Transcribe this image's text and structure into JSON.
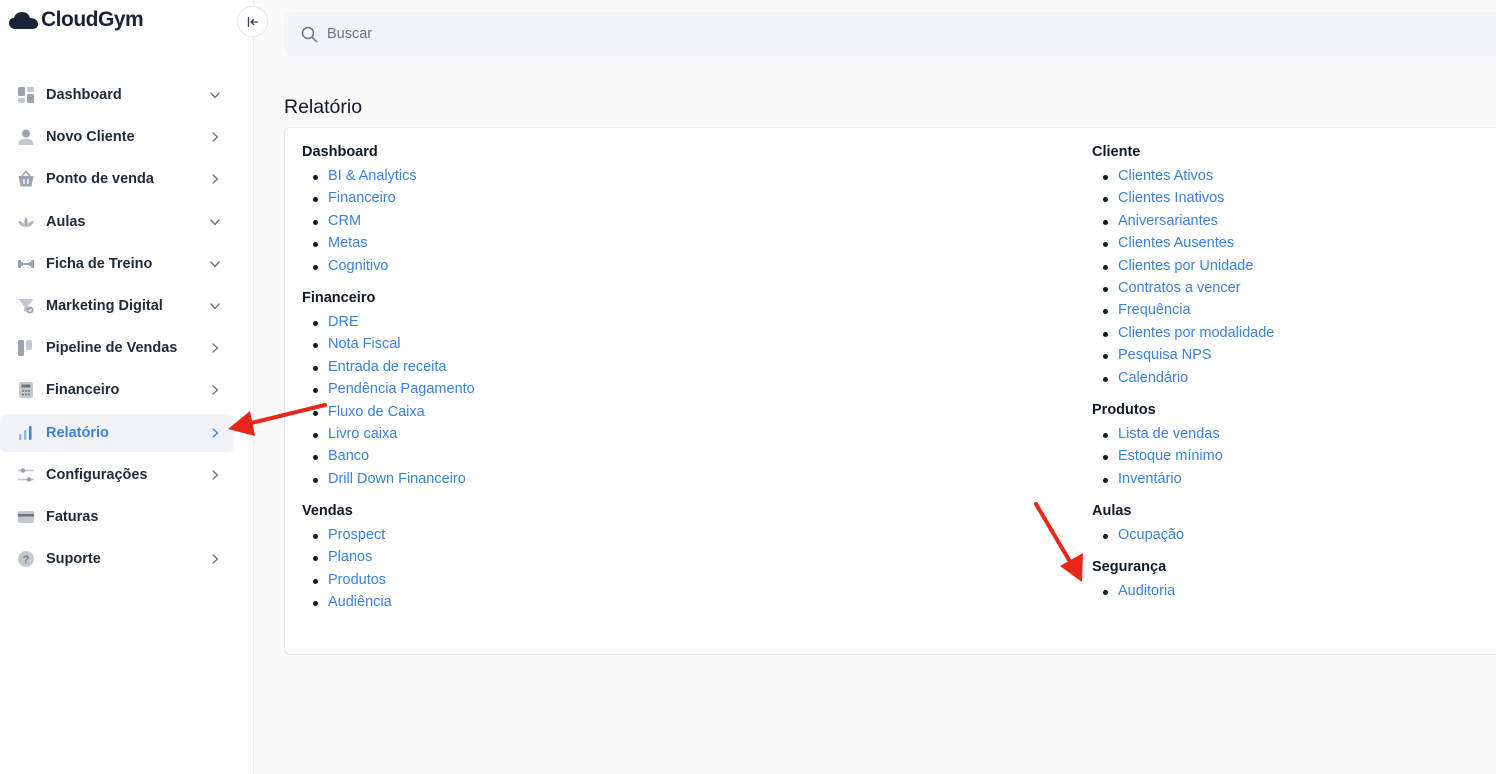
{
  "app": {
    "logo_text": "CloudGym"
  },
  "search": {
    "placeholder": "Buscar"
  },
  "sidebar": {
    "items": [
      {
        "label": "Dashboard",
        "icon": "grid-icon",
        "chevron": "down"
      },
      {
        "label": "Novo Cliente",
        "icon": "user-icon",
        "chevron": "right"
      },
      {
        "label": "Ponto de venda",
        "icon": "basket-icon",
        "chevron": "right"
      },
      {
        "label": "Aulas",
        "icon": "lotus-icon",
        "chevron": "down"
      },
      {
        "label": "Ficha de Treino",
        "icon": "dumbbell-icon",
        "chevron": "down"
      },
      {
        "label": "Marketing Digital",
        "icon": "funnel-icon",
        "chevron": "down"
      },
      {
        "label": "Pipeline de Vendas",
        "icon": "kanban-icon",
        "chevron": "right"
      },
      {
        "label": "Financeiro",
        "icon": "calculator-icon",
        "chevron": "right"
      },
      {
        "label": "Relatório",
        "icon": "bar-chart-icon",
        "chevron": "right",
        "active": true
      },
      {
        "label": "Configurações",
        "icon": "sliders-icon",
        "chevron": "right"
      },
      {
        "label": "Faturas",
        "icon": "credit-card-icon",
        "chevron": "none"
      },
      {
        "label": "Suporte",
        "icon": "help-icon",
        "chevron": "right"
      }
    ]
  },
  "main": {
    "title": "Relatório",
    "left_sections": [
      {
        "title": "Dashboard",
        "links": [
          "BI & Analytics",
          "Financeiro",
          "CRM",
          "Metas",
          "Cognitivo"
        ]
      },
      {
        "title": "Financeiro",
        "links": [
          "DRE",
          "Nota Fiscal",
          "Entrada de receita",
          "Pendência Pagamento",
          "Fluxo de Caixa",
          "Livro caixa",
          "Banco",
          "Drill Down Financeiro"
        ]
      },
      {
        "title": "Vendas",
        "links": [
          "Prospect",
          "Planos",
          "Produtos",
          "Audiência"
        ]
      }
    ],
    "right_sections": [
      {
        "title": "Cliente",
        "links": [
          "Clientes Ativos",
          "Clientes Inativos",
          "Aniversariantes",
          "Clientes Ausentes",
          "Clientes por Unidade",
          "Contratos a vencer",
          "Frequência",
          "Clientes por modalidade",
          "Pesquisa NPS",
          "Calendário"
        ]
      },
      {
        "title": "Produtos",
        "links": [
          "Lista de vendas",
          "Estoque mínimo",
          "Inventário"
        ]
      },
      {
        "title": "Aulas",
        "links": [
          "Ocupação"
        ]
      },
      {
        "title": "Segurança",
        "links": [
          "Auditoria"
        ]
      }
    ]
  },
  "colors": {
    "accent": "#3b82d6",
    "annotation_arrow": "#e8261c",
    "logo": "#1a2238"
  }
}
